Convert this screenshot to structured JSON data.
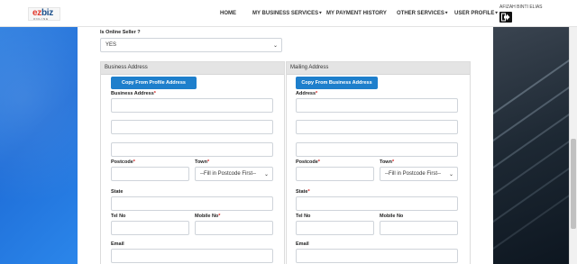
{
  "header": {
    "logo_main": "ez",
    "logo_accent": "biz",
    "logo_sub": "ONLINE",
    "nav": [
      {
        "label": "HOME",
        "dropdown": false
      },
      {
        "label": "MY BUSINESS SERVICES",
        "dropdown": true
      },
      {
        "label": "MY PAYMENT HISTORY",
        "dropdown": false
      },
      {
        "label": "OTHER SERVICES",
        "dropdown": true
      },
      {
        "label": "USER PROFILE",
        "dropdown": true
      }
    ],
    "user_name": "AFIZAH BINTI ELIAS",
    "logout_icon": "logout-icon"
  },
  "form": {
    "online_seller_label": "Is Online Seller ?",
    "online_seller_value": "YES",
    "business": {
      "title": "Business Address",
      "copy_button": "Copy From Profile Address",
      "address_label": "Business Address",
      "postcode_label": "Postcode",
      "town_label": "Town",
      "town_placeholder": "--Fill in Postcode First--",
      "state_label": "State",
      "tel_label": "Tel No",
      "mobile_label": "Mobile No",
      "email_label": "Email"
    },
    "mailing": {
      "title": "Mailing Address",
      "copy_button": "Copy From Business Address",
      "address_label": "Address",
      "postcode_label": "Postcode",
      "town_label": "Town",
      "town_placeholder": "--Fill in Postcode First--",
      "state_label": "State",
      "tel_label": "Tel No",
      "mobile_label": "Mobile No",
      "email_label": "Email"
    },
    "required_mark": "*",
    "dropdown_arrow": "⌄"
  },
  "colors": {
    "primary_button": "#1e7fcc",
    "required": "#d62020",
    "logo_red": "#e23a2e",
    "logo_blue": "#1b4f8a"
  }
}
